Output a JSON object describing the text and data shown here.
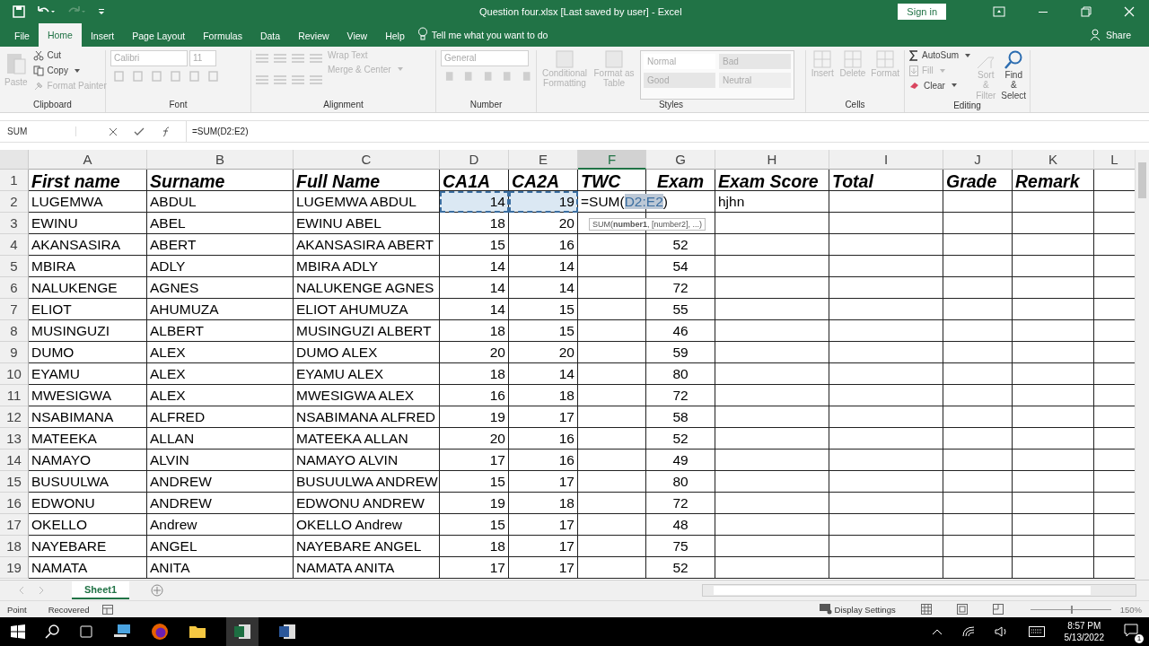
{
  "title_bar": {
    "title": "Question four.xlsx [Last saved by user]  -  Excel",
    "sign_in": "Sign in"
  },
  "menu_tabs": [
    {
      "label": "File",
      "selected": false
    },
    {
      "label": "Home",
      "selected": true
    },
    {
      "label": "Insert",
      "selected": false
    },
    {
      "label": "Page Layout",
      "selected": false
    },
    {
      "label": "Formulas",
      "selected": false
    },
    {
      "label": "Data",
      "selected": false
    },
    {
      "label": "Review",
      "selected": false
    },
    {
      "label": "View",
      "selected": false
    },
    {
      "label": "Help",
      "selected": false
    }
  ],
  "tell_me": "Tell me what you want to do",
  "share": "Share",
  "ribbon": {
    "clipboard": {
      "label": "Clipboard",
      "paste": {
        "label": "Paste",
        "disabled": true
      },
      "cut": {
        "label": "Cut",
        "disabled": false
      },
      "copy": {
        "label": "Copy",
        "disabled": false
      },
      "painter": {
        "label": "Format Painter",
        "disabled": true
      }
    },
    "font": {
      "label": "Font",
      "family": "Calibri",
      "size": "11"
    },
    "alignment": {
      "label": "Alignment",
      "wrap": "Wrap Text",
      "merge": "Merge & Center"
    },
    "number": {
      "label": "Number",
      "format": "General"
    },
    "styles": {
      "label": "Styles",
      "conditional": "Conditional Formatting",
      "format_table": "Format as Table",
      "cells": [
        {
          "label": "Normal",
          "kind": "normal"
        },
        {
          "label": "Bad",
          "kind": "bad"
        },
        {
          "label": "Good",
          "kind": "good"
        },
        {
          "label": "Neutral",
          "kind": "neutral"
        }
      ]
    },
    "cells": {
      "label": "Cells",
      "buttons": [
        "Insert",
        "Delete",
        "Format"
      ]
    },
    "editing": {
      "label": "Editing",
      "autosum": {
        "label": "AutoSum",
        "disabled": false
      },
      "fill": {
        "label": "Fill",
        "disabled": true
      },
      "clear": {
        "label": "Clear",
        "disabled": false
      },
      "sort": {
        "label": "Sort & Filter",
        "disabled": true
      },
      "find": {
        "label": "Find & Select",
        "disabled": false
      }
    }
  },
  "formula_bar": {
    "name_box": "SUM",
    "formula": "=SUM(D2:E2)"
  },
  "columns": [
    {
      "letter": "A",
      "selected": false
    },
    {
      "letter": "B",
      "selected": false
    },
    {
      "letter": "C",
      "selected": false
    },
    {
      "letter": "D",
      "selected": false
    },
    {
      "letter": "E",
      "selected": false
    },
    {
      "letter": "F",
      "selected": true
    },
    {
      "letter": "G",
      "selected": false
    },
    {
      "letter": "H",
      "selected": false
    },
    {
      "letter": "I",
      "selected": false
    },
    {
      "letter": "J",
      "selected": false
    },
    {
      "letter": "K",
      "selected": false
    },
    {
      "letter": "L",
      "selected": false
    }
  ],
  "rows": [
    {
      "row": "1",
      "kind": "header",
      "first": "First name",
      "surname": "Surname",
      "full": "Full Name",
      "ca1a": "CA1A",
      "ca2a": "CA2A",
      "twc": "TWC",
      "exam": "Exam",
      "exam_score": "Exam Score",
      "total": "Total",
      "grade": "Grade",
      "remark": "Remark"
    },
    {
      "row": "2",
      "kind": "data",
      "referenced": true,
      "first": "LUGEMWA",
      "surname": "ABDUL",
      "full": "LUGEMWA ABDUL",
      "ca1a": "14",
      "ca2a": "19",
      "editing": {
        "prefix": "=SUM(",
        "ref": "D2:E2",
        "suffix": ")"
      },
      "exam_score": "hjhn"
    },
    {
      "row": "3",
      "kind": "data",
      "referenced": false,
      "first": "EWINU",
      "surname": "ABEL",
      "full": "EWINU ABEL",
      "ca1a": "18",
      "ca2a": "20"
    },
    {
      "row": "4",
      "kind": "data",
      "referenced": false,
      "first": "AKANSASIRA",
      "surname": "ABERT",
      "full": "AKANSASIRA ABERT",
      "ca1a": "15",
      "ca2a": "16",
      "exam": "52"
    },
    {
      "row": "5",
      "kind": "data",
      "referenced": false,
      "first": "MBIRA",
      "surname": "ADLY",
      "full": "MBIRA ADLY",
      "ca1a": "14",
      "ca2a": "14",
      "exam": "54"
    },
    {
      "row": "6",
      "kind": "data",
      "referenced": false,
      "first": "NALUKENGE",
      "surname": "AGNES",
      "full": "NALUKENGE AGNES",
      "ca1a": "14",
      "ca2a": "14",
      "exam": "72"
    },
    {
      "row": "7",
      "kind": "data",
      "referenced": false,
      "first": "ELIOT",
      "surname": "AHUMUZA",
      "full": "ELIOT AHUMUZA",
      "ca1a": "14",
      "ca2a": "15",
      "exam": "55"
    },
    {
      "row": "8",
      "kind": "data",
      "referenced": false,
      "first": "MUSINGUZI",
      "surname": "ALBERT",
      "full": "MUSINGUZI ALBERT",
      "ca1a": "18",
      "ca2a": "15",
      "exam": "46"
    },
    {
      "row": "9",
      "kind": "data",
      "referenced": false,
      "first": "DUMO",
      "surname": "ALEX",
      "full": "DUMO ALEX",
      "ca1a": "20",
      "ca2a": "20",
      "exam": "59"
    },
    {
      "row": "10",
      "kind": "data",
      "referenced": false,
      "first": "EYAMU",
      "surname": "ALEX",
      "full": "EYAMU ALEX",
      "ca1a": "18",
      "ca2a": "14",
      "exam": "80"
    },
    {
      "row": "11",
      "kind": "data",
      "referenced": false,
      "first": "MWESIGWA",
      "surname": "ALEX",
      "full": "MWESIGWA ALEX",
      "ca1a": "16",
      "ca2a": "18",
      "exam": "72"
    },
    {
      "row": "12",
      "kind": "data",
      "referenced": false,
      "first": "NSABIMANA",
      "surname": "ALFRED",
      "full": "NSABIMANA ALFRED",
      "ca1a": "19",
      "ca2a": "17",
      "exam": "58"
    },
    {
      "row": "13",
      "kind": "data",
      "referenced": false,
      "first": "MATEEKA",
      "surname": "ALLAN",
      "full": "MATEEKA ALLAN",
      "ca1a": "20",
      "ca2a": "16",
      "exam": "52"
    },
    {
      "row": "14",
      "kind": "data",
      "referenced": false,
      "first": "NAMAYO",
      "surname": "ALVIN",
      "full": "NAMAYO ALVIN",
      "ca1a": "17",
      "ca2a": "16",
      "exam": "49"
    },
    {
      "row": "15",
      "kind": "data",
      "referenced": false,
      "first": "BUSUULWA",
      "surname": "ANDREW",
      "full": "BUSUULWA ANDREW",
      "ca1a": "15",
      "ca2a": "17",
      "exam": "80"
    },
    {
      "row": "16",
      "kind": "data",
      "referenced": false,
      "first": "EDWONU",
      "surname": "ANDREW",
      "full": "EDWONU ANDREW",
      "ca1a": "19",
      "ca2a": "18",
      "exam": "72"
    },
    {
      "row": "17",
      "kind": "data",
      "referenced": false,
      "first": "OKELLO",
      "surname": "Andrew",
      "full": "OKELLO Andrew",
      "ca1a": "15",
      "ca2a": "17",
      "exam": "48"
    },
    {
      "row": "18",
      "kind": "data",
      "referenced": false,
      "first": "NAYEBARE",
      "surname": "ANGEL",
      "full": "NAYEBARE ANGEL",
      "ca1a": "18",
      "ca2a": "17",
      "exam": "75"
    },
    {
      "row": "19",
      "kind": "data",
      "referenced": false,
      "first": "NAMATA",
      "surname": "ANITA",
      "full": "NAMATA ANITA",
      "ca1a": "17",
      "ca2a": "17",
      "exam": "52"
    }
  ],
  "tooltip": "SUM(**number1**, [number2], ...)",
  "sheet_tabs": [
    {
      "label": "Sheet1",
      "selected": true
    }
  ],
  "status_bar": {
    "mode": "Point",
    "recovered": "Recovered",
    "display_settings": "Display Settings",
    "zoom_slider": {
      "level": 0.5
    },
    "zoom": "150%"
  },
  "taskbar": {
    "time": "8:57 PM",
    "date": "5/13/2022",
    "notifications": "1"
  }
}
